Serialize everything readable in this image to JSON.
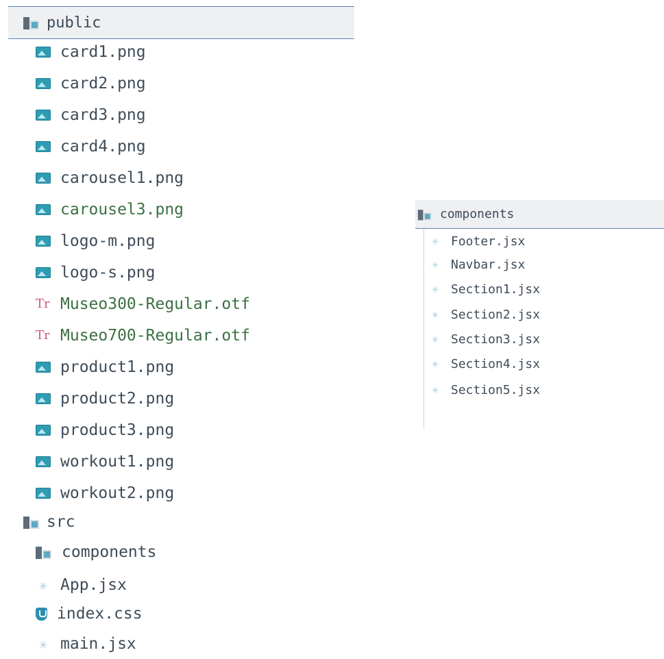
{
  "public_folder": {
    "name": "public",
    "files": [
      {
        "name": "card1.png",
        "icon": "image-icon"
      },
      {
        "name": "card2.png",
        "icon": "image-icon"
      },
      {
        "name": "card3.png",
        "icon": "image-icon"
      },
      {
        "name": "card4.png",
        "icon": "image-icon"
      },
      {
        "name": "carousel1.png",
        "icon": "image-icon"
      },
      {
        "name": "carousel3.png",
        "icon": "image-icon"
      },
      {
        "name": "logo-m.png",
        "icon": "image-icon"
      },
      {
        "name": "logo-s.png",
        "icon": "image-icon"
      },
      {
        "name": "Museo300-Regular.otf",
        "icon": "font-icon"
      },
      {
        "name": "Museo700-Regular.otf",
        "icon": "font-icon"
      },
      {
        "name": "product1.png",
        "icon": "image-icon"
      },
      {
        "name": "product2.png",
        "icon": "image-icon"
      },
      {
        "name": "product3.png",
        "icon": "image-icon"
      },
      {
        "name": "workout1.png",
        "icon": "image-icon"
      },
      {
        "name": "workout2.png",
        "icon": "image-icon"
      }
    ]
  },
  "src_folder": {
    "name": "src",
    "children": [
      {
        "name": "components",
        "icon": "folder-icon"
      },
      {
        "name": "App.jsx",
        "icon": "react-icon"
      },
      {
        "name": "index.css",
        "icon": "css-icon"
      },
      {
        "name": "main.jsx",
        "icon": "react-icon"
      }
    ]
  },
  "components_folder": {
    "name": "components",
    "files": [
      {
        "name": "Footer.jsx",
        "icon": "react-icon"
      },
      {
        "name": "Navbar.jsx",
        "icon": "react-icon"
      },
      {
        "name": "Section1.jsx",
        "icon": "react-icon"
      },
      {
        "name": "Section2.jsx",
        "icon": "react-icon"
      },
      {
        "name": "Section3.jsx",
        "icon": "react-icon"
      },
      {
        "name": "Section4.jsx",
        "icon": "react-icon"
      },
      {
        "name": "Section5.jsx",
        "icon": "react-icon"
      }
    ]
  },
  "colors": {
    "image_icon": "#2e9cb3",
    "font_icon": "#d2577e",
    "modified_text": "#3b7042",
    "header_bg": "#eef0f2",
    "header_border": "#5a7fb6"
  }
}
